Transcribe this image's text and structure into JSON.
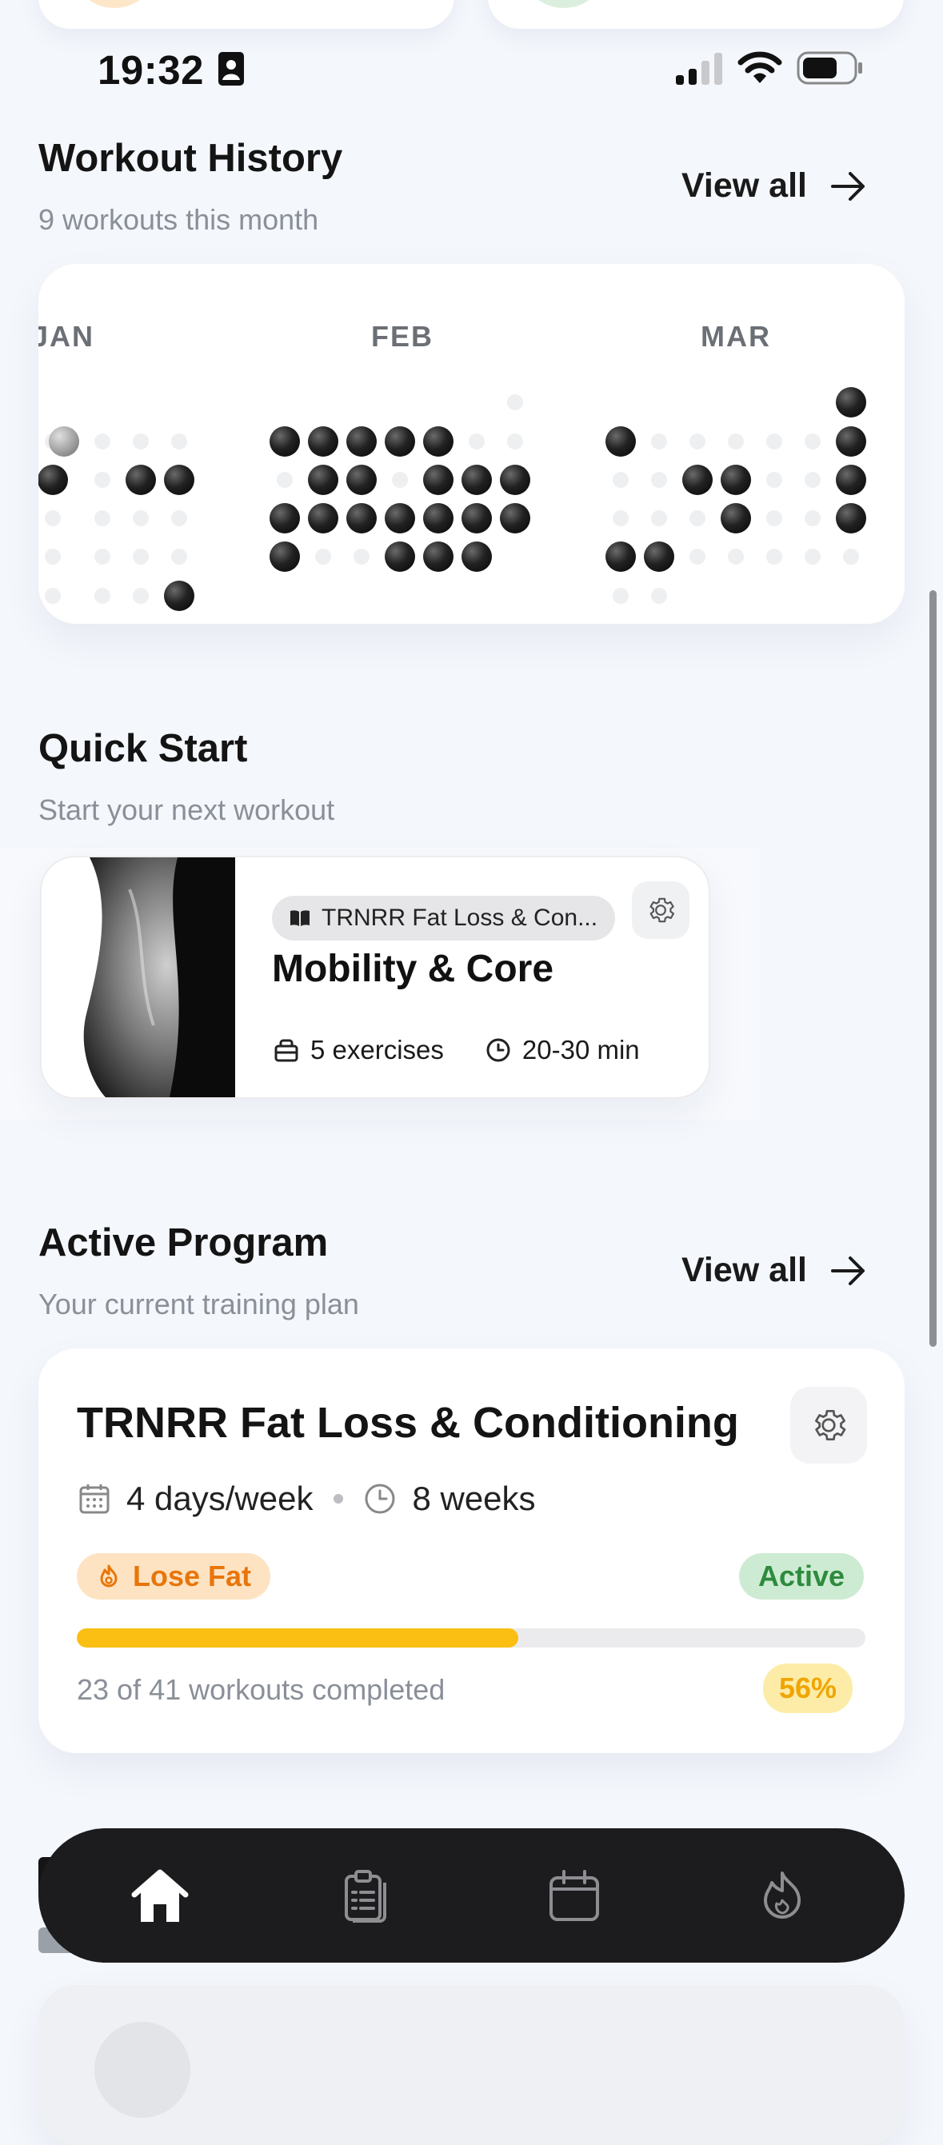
{
  "status_bar": {
    "time": "19:32"
  },
  "workout_history": {
    "title": "Workout History",
    "subtitle": "9 workouts this month",
    "view_all": "View all",
    "months": [
      "JAN",
      "FEB",
      "MAR"
    ]
  },
  "quick_start": {
    "title": "Quick Start",
    "subtitle": "Start your next workout",
    "card": {
      "program_tag": "TRNRR Fat Loss & Con...",
      "workout_name": "Mobility & Core",
      "exercises": "5 exercises",
      "duration": "20-30 min"
    }
  },
  "active_program": {
    "title": "Active Program",
    "subtitle": "Your current training plan",
    "view_all": "View all",
    "program_name": "TRNRR Fat Loss & Conditioning",
    "frequency": "4 days/week",
    "length": "8 weeks",
    "goal_badge": "Lose Fat",
    "status_badge": "Active",
    "progress_fraction": 0.56,
    "progress_text": "23 of 41 workouts completed",
    "progress_percent": "56%"
  },
  "colors": {
    "accent_yellow": "#fbbf14",
    "goal_orange": "#e8750a",
    "goal_bg": "#fde3c2",
    "active_green": "#2e8b3e",
    "active_bg": "#cdebd2",
    "nav_bg": "#1c1c1e"
  },
  "bottom_nav": {
    "items": [
      {
        "icon": "home-icon",
        "active": true
      },
      {
        "icon": "clipboard-icon",
        "active": false
      },
      {
        "icon": "calendar-icon",
        "active": false
      },
      {
        "icon": "flame-icon",
        "active": false
      }
    ]
  }
}
